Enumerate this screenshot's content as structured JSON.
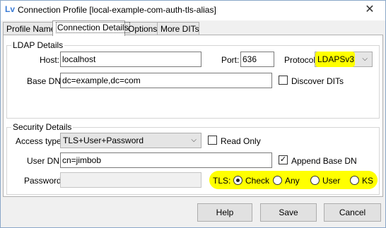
{
  "window": {
    "title": "Connection Profile [local-example-com-auth-tls-alias]",
    "icon": "Lv",
    "close_glyph": "✕"
  },
  "tabs": [
    {
      "label": "Profile Name"
    },
    {
      "label": "Connection Details"
    },
    {
      "label": "Options"
    },
    {
      "label": "More DITs"
    }
  ],
  "ldap": {
    "group_title": "LDAP Details",
    "host_label": "Host:",
    "host_value": "localhost",
    "port_label": "Port:",
    "port_value": "636",
    "protocol_label": "Protocol:",
    "protocol_value": "LDAPSv3",
    "basedn_label": "Base DN:",
    "basedn_value": "dc=example,dc=com",
    "discover_label": "Discover DITs",
    "discover_checked": false
  },
  "security": {
    "group_title": "Security Details",
    "access_label": "Access type:",
    "access_value": "TLS+User+Password",
    "readonly_label": "Read Only",
    "readonly_checked": false,
    "userdn_label": "User DN:",
    "userdn_value": "cn=jimbob",
    "append_label": "Append Base DN",
    "append_checked": true,
    "password_label": "Password:",
    "password_value": "",
    "tls_label": "TLS:",
    "tls_options": [
      {
        "label": "Check",
        "selected": true
      },
      {
        "label": "Any",
        "selected": false
      },
      {
        "label": "User",
        "selected": false
      },
      {
        "label": "KS",
        "selected": false
      }
    ]
  },
  "buttons": {
    "help": "Help",
    "save": "Save",
    "cancel": "Cancel"
  },
  "colors": {
    "highlight": "#ffff00",
    "accent": "#3a7bd5"
  },
  "icons": {
    "checkmark": "✓",
    "combo_arrow": "⌵"
  }
}
